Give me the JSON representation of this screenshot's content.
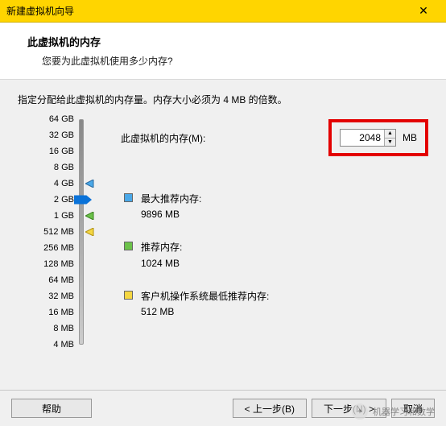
{
  "titlebar": {
    "title": "新建虚拟机向导",
    "close": "✕"
  },
  "header": {
    "title": "此虚拟机的内存",
    "sub": "您要为此虚拟机使用多少内存?"
  },
  "desc": "指定分配给此虚拟机的内存量。内存大小必须为 4 MB 的倍数。",
  "memory": {
    "label": "此虚拟机的内存(M):",
    "value": "2048",
    "unit": "MB"
  },
  "legend": {
    "max": {
      "label": "最大推荐内存:",
      "value": "9896 MB"
    },
    "rec": {
      "label": "推荐内存:",
      "value": "1024 MB"
    },
    "min": {
      "label": "客户机操作系统最低推荐内存:",
      "value": "512 MB"
    }
  },
  "ticks": [
    "64 GB",
    "32 GB",
    "16 GB",
    "8 GB",
    "4 GB",
    "2 GB",
    "1 GB",
    "512 MB",
    "256 MB",
    "128 MB",
    "64 MB",
    "32 MB",
    "16 MB",
    "8 MB",
    "4 MB"
  ],
  "buttons": {
    "help": "帮助",
    "back": "< 上一步(B)",
    "next": "下一步(N) >",
    "cancel": "取消"
  },
  "watermark": "机器学习和数学"
}
